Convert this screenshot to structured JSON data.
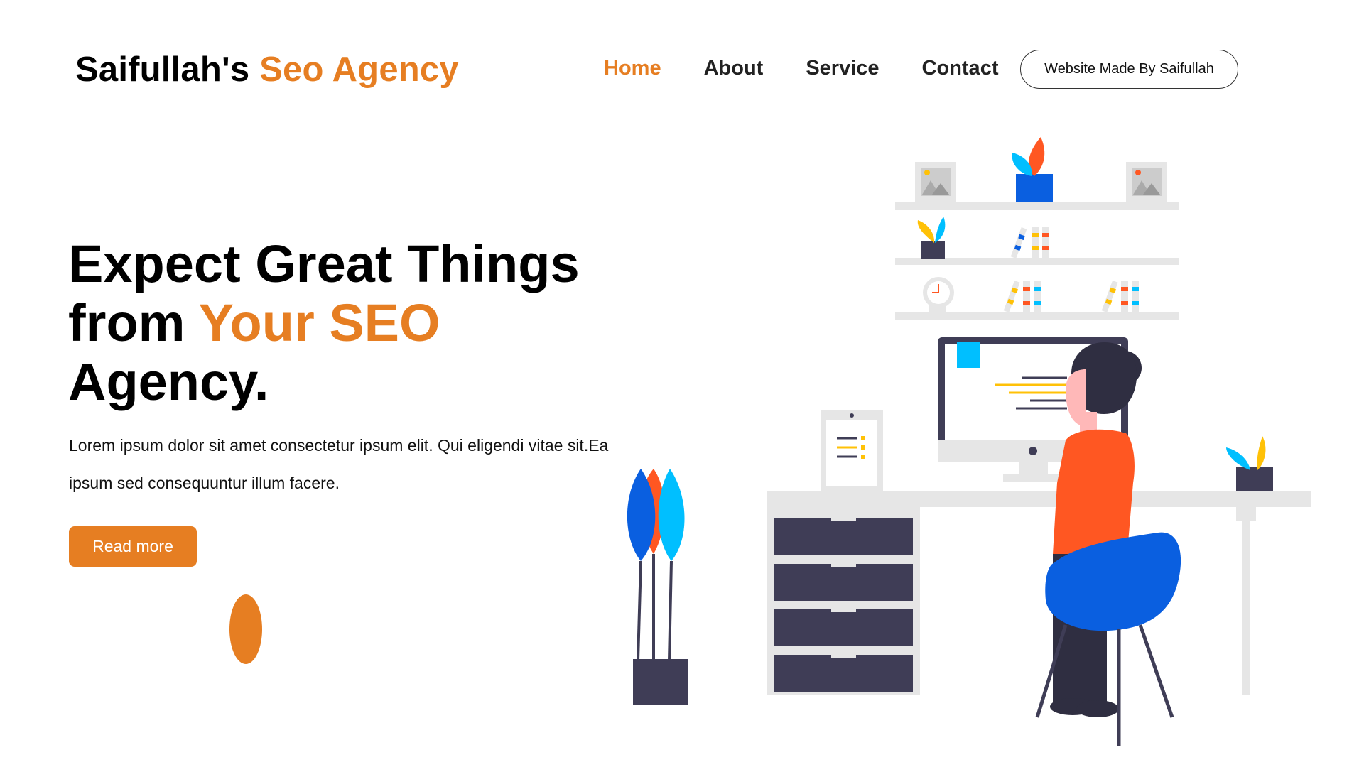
{
  "header": {
    "logo_part1": "Saifullah's",
    "logo_part2": "Seo Agency",
    "nav": [
      {
        "label": "Home",
        "active": true
      },
      {
        "label": "About",
        "active": false
      },
      {
        "label": "Service",
        "active": false
      },
      {
        "label": "Contact",
        "active": false
      }
    ],
    "made_by_button": "Website Made By Saifullah"
  },
  "hero": {
    "title_line1": "Expect Great Things",
    "title_line2_prefix": "from",
    "title_line2_accent": "Your SEO",
    "title_line3": "Agency.",
    "description": "Lorem ipsum dolor sit amet consectetur ipsum elit. Qui eligendi vitae sit.Ea ipsum sed consequuntur illum facere.",
    "cta_label": "Read more"
  },
  "colors": {
    "accent": "#e67e22",
    "dark": "#3f3d56",
    "blue": "#0a5fe0",
    "cyan": "#00bfff",
    "red_orange": "#ff5722",
    "yellow": "#ffc107",
    "light_gray": "#e6e6e6"
  },
  "illustration": {
    "subject": "woman working at desk with computer, shelves, plants and drawers",
    "icons": [
      "picture-frame-icon",
      "plant-icon",
      "books-icon",
      "clock-icon",
      "monitor-icon",
      "tablet-icon",
      "drawer-cabinet-icon",
      "chair-icon"
    ]
  }
}
